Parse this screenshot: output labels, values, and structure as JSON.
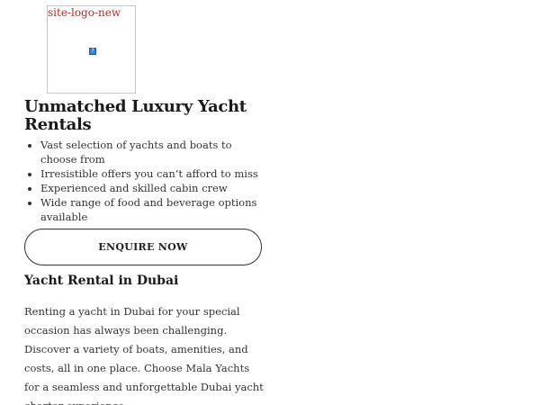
{
  "logo": {
    "alt_text": "site-logo-new",
    "icon": "broken-image-icon"
  },
  "hero": {
    "title": "Unmatched Luxury Yacht Rentals",
    "features": [
      "Vast selection of yachts and boats to choose from",
      "Irresistible offers you can’t afford to miss",
      "Experienced and skilled cabin crew",
      "Wide range of food and beverage options available"
    ],
    "cta_label": "ENQUIRE NOW"
  },
  "section": {
    "title": "Yacht Rental in Dubai",
    "body": "Renting a yacht in Dubai for your special occasion has always been challenging. Discover a variety of boats, amenities, and costs, all in one place. Choose Mala Yachts for a seamless and unforgettable Dubai yacht charter experience."
  }
}
